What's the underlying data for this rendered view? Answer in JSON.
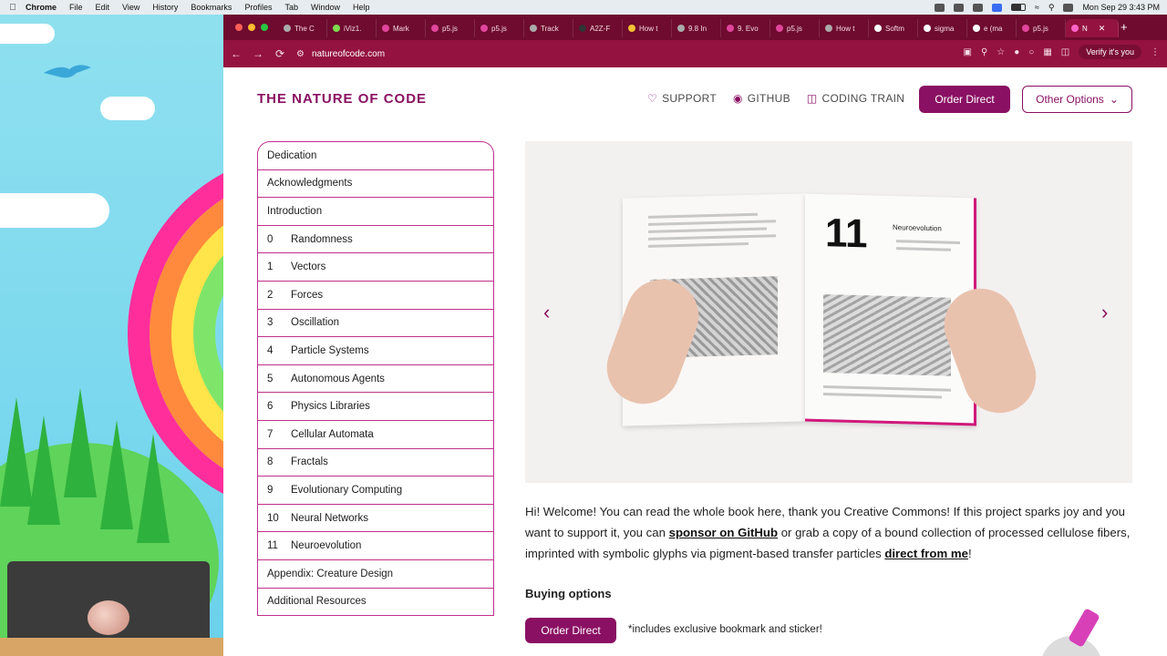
{
  "menubar": {
    "apple": "",
    "items": [
      "Chrome",
      "File",
      "Edit",
      "View",
      "History",
      "Bookmarks",
      "Profiles",
      "Tab",
      "Window",
      "Help"
    ],
    "clock": "Mon Sep 29  3:43 PM"
  },
  "browser": {
    "tabs": [
      "The C",
      "iViz1.",
      "Mark",
      "p5.js",
      "p5.js",
      "Track",
      "A2Z-F",
      "How t",
      "9.8 In",
      "9. Evo",
      "p5.js",
      "How t",
      "Softm",
      "sigma",
      "e (ma",
      "p5.js",
      "N"
    ],
    "new_tab": "+",
    "back": "←",
    "forward": "→",
    "reload": "⟳",
    "url": "natureofcode.com",
    "verify": "Verify it's you"
  },
  "site": {
    "title": "THE NATURE OF CODE",
    "nav": {
      "support": "SUPPORT",
      "github": "GITHUB",
      "coding_train": "CODING TRAIN"
    },
    "order_direct": "Order Direct",
    "other_options": "Other Options"
  },
  "toc": [
    {
      "num": "",
      "label": "Dedication"
    },
    {
      "num": "",
      "label": "Acknowledgments"
    },
    {
      "num": "",
      "label": "Introduction"
    },
    {
      "num": "0",
      "label": "Randomness"
    },
    {
      "num": "1",
      "label": "Vectors"
    },
    {
      "num": "2",
      "label": "Forces"
    },
    {
      "num": "3",
      "label": "Oscillation"
    },
    {
      "num": "4",
      "label": "Particle Systems"
    },
    {
      "num": "5",
      "label": "Autonomous Agents"
    },
    {
      "num": "6",
      "label": "Physics Libraries"
    },
    {
      "num": "7",
      "label": "Cellular Automata"
    },
    {
      "num": "8",
      "label": "Fractals"
    },
    {
      "num": "9",
      "label": "Evolutionary Computing"
    },
    {
      "num": "10",
      "label": "Neural Networks"
    },
    {
      "num": "11",
      "label": "Neuroevolution"
    },
    {
      "num": "",
      "label": "Appendix: Creature Design"
    },
    {
      "num": "",
      "label": "Additional Resources"
    }
  ],
  "carousel": {
    "chapter_number": "11",
    "chapter_title": "Neuroevolution",
    "prev": "‹",
    "next": "›"
  },
  "intro": {
    "part1": "Hi! Welcome! You can read the whole book here, thank you Creative Commons! If this project sparks joy and you want to support it, you can ",
    "link1": "sponsor on GitHub",
    "part2": " or grab a copy of a bound collection of processed cellulose fibers, imprinted with symbolic glyphs via pigment-based transfer particles ",
    "link2": "direct from me",
    "part3": "!"
  },
  "buying": {
    "heading": "Buying options",
    "button": "Order Direct",
    "note": "*includes exclusive bookmark and sticker!"
  },
  "colors": {
    "brand": "#8a1063",
    "tab_strip": "#6e0b2e",
    "toolbar": "#94123f",
    "toc_border": "#c0308c"
  }
}
